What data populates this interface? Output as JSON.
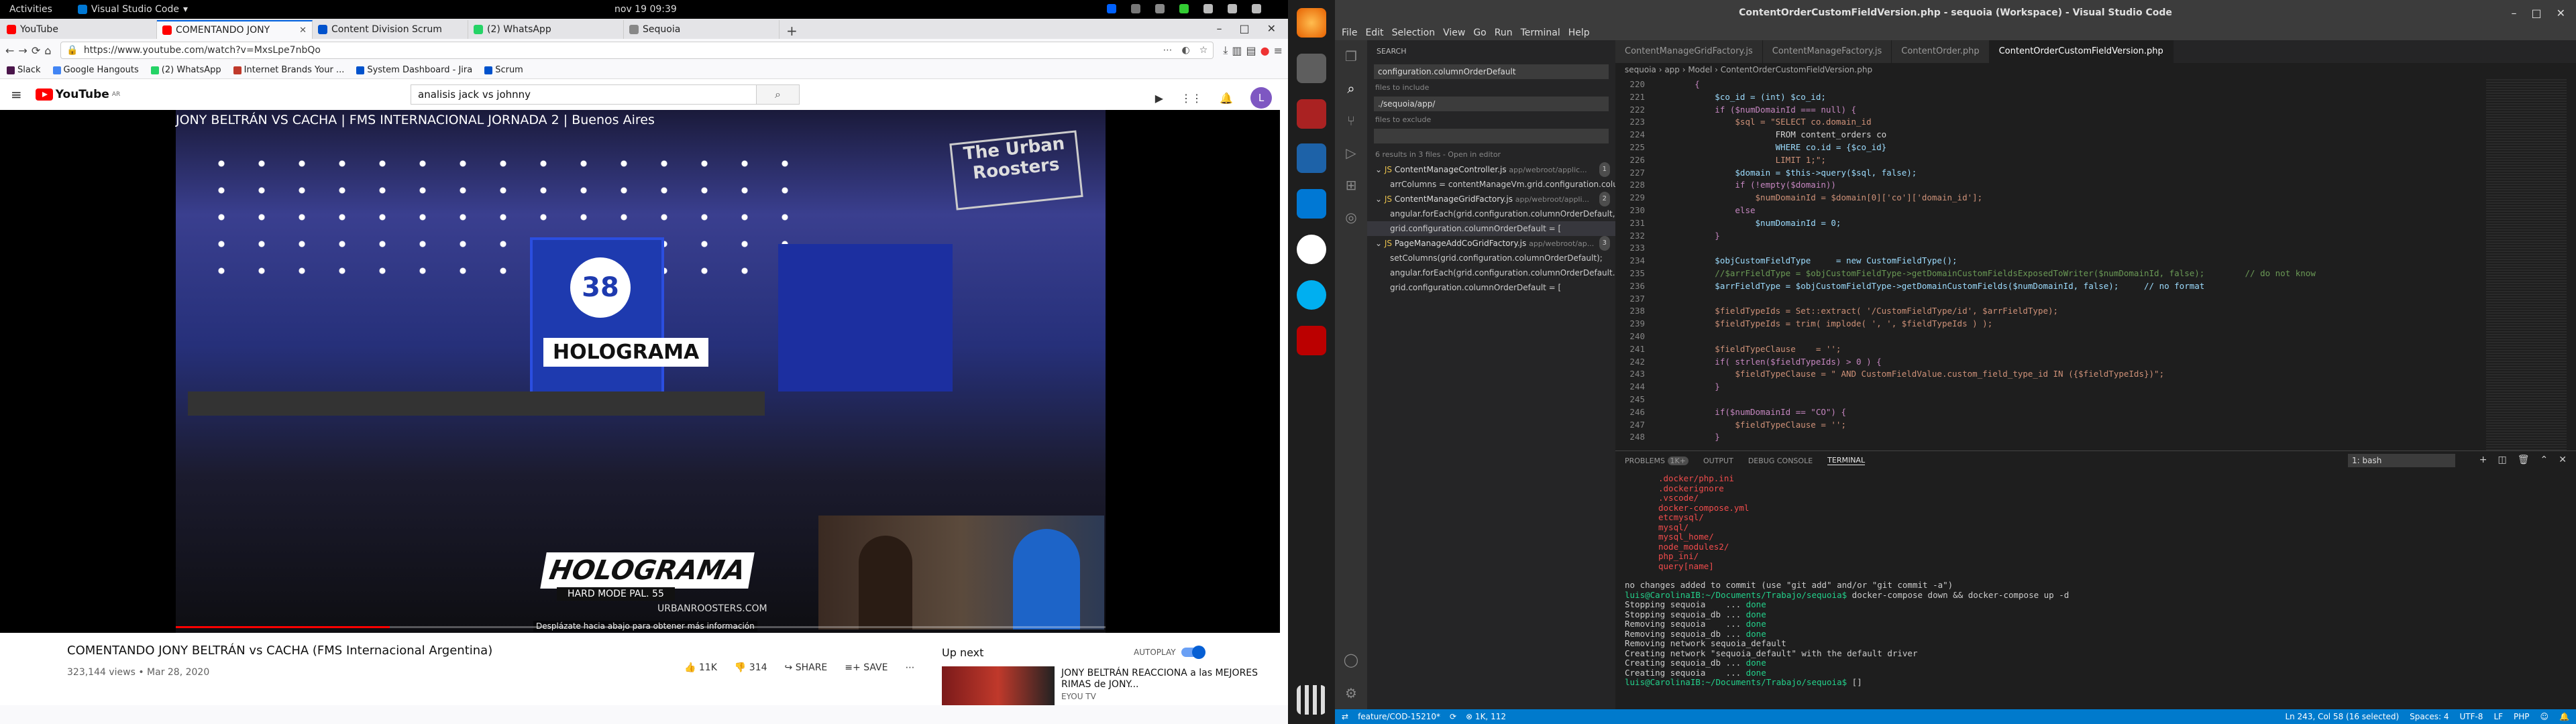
{
  "gnome": {
    "activities": "Activities",
    "app": "Visual Studio Code",
    "clock": "nov 19  09:39"
  },
  "firefox": {
    "tabs": [
      {
        "label": "YouTube",
        "color": "#ff0000"
      },
      {
        "label": "COMENTANDO JONY",
        "color": "#ff0000"
      },
      {
        "label": "Content Division Scrum",
        "color": "#0052cc"
      },
      {
        "label": "(2) WhatsApp",
        "color": "#25d366"
      },
      {
        "label": "Sequoia",
        "color": "#555555"
      }
    ],
    "url": "https://www.youtube.com/watch?v=MxsLpe7nbQo",
    "bookmarks": [
      "Slack",
      "Google Hangouts",
      "(2) WhatsApp",
      "Internet Brands Your ...",
      "System Dashboard - Jira",
      "Scrum"
    ]
  },
  "youtube": {
    "logo": "YouTube",
    "country": "AR",
    "search_value": "analisis jack vs johnny",
    "avatar": "L",
    "video_overlay_title": "JONY BELTRÁN VS CACHA | FMS INTERNACIONAL JORNADA 2 | Buenos Aires",
    "overlay": {
      "badge": "38",
      "hologram": "HOLOGRAMA",
      "hard": "HARD MODE    PAL. 55",
      "site": "URBANROOSTERS.COM",
      "mid": "HOLOGRAMA",
      "logo": "The Urban Roosters",
      "caption": "Desplázate hacia abajo para obtener más información"
    },
    "progress_fraction": 0.23,
    "title": "COMENTANDO JONY BELTRÁN vs CACHA (FMS Internacional Argentina)",
    "views": "323,144 views • Mar 28, 2020",
    "likes": "11K",
    "dislikes": "314",
    "share": "SHARE",
    "save": "SAVE",
    "up_next": "Up next",
    "autoplay": "AUTOPLAY",
    "next_title": "JONY BELTRÁN REACCIONA a las MEJORES RIMAS de JONY...",
    "next_channel": "EYOU TV"
  },
  "vscode": {
    "title": "ContentOrderCustomFieldVersion.php - sequoia (Workspace) - Visual Studio Code",
    "menu": [
      "File",
      "Edit",
      "Selection",
      "View",
      "Go",
      "Run",
      "Terminal",
      "Help"
    ],
    "search": {
      "header": "SEARCH",
      "query": "configuration.columnOrderDefault",
      "include_label": "files to include",
      "include": "./sequoia/app/",
      "exclude_label": "files to exclude",
      "summary": "6 results in 3 files - Open in editor",
      "results": [
        {
          "file": "ContentManageController.js",
          "path": "app/webroot/applic...",
          "count": "1",
          "matches": [
            "arrColumns = contentManageVm.grid.configuration.colum..."
          ]
        },
        {
          "file": "ContentManageGridFactory.js",
          "path": "app/webroot/appli...",
          "count": "2",
          "matches": [
            "angular.forEach(grid.configuration.columnOrderDefault,...",
            "grid.configuration.columnOrderDefault = ["
          ]
        },
        {
          "file": "PageManageAddCoGridFactory.js",
          "path": "app/webroot/ap...",
          "count": "3",
          "matches": [
            "setColumns(grid.configuration.columnOrderDefault);",
            "angular.forEach(grid.configuration.columnOrderDefault...",
            "grid.configuration.columnOrderDefault = ["
          ]
        }
      ]
    },
    "tabs": [
      "ContentManageGridFactory.js",
      "ContentManageFactory.js",
      "ContentOrder.php",
      "ContentOrderCustomFieldVersion.php"
    ],
    "breadcrumb": "sequoia › app › Model › ContentOrderCustomFieldVersion.php",
    "lines": [
      {
        "n": "220",
        "t": "        {"
      },
      {
        "n": "221",
        "t": "            $co_id = (int) $co_id;"
      },
      {
        "n": "222",
        "t": "            if ($numDomainId === null) {"
      },
      {
        "n": "223",
        "t": "                $sql = \"SELECT co.domain_id"
      },
      {
        "n": "224",
        "t": "                        FROM content_orders co"
      },
      {
        "n": "225",
        "t": "                        WHERE co.id = {$co_id}"
      },
      {
        "n": "226",
        "t": "                        LIMIT 1;\";"
      },
      {
        "n": "227",
        "t": "                $domain = $this->query($sql, false);"
      },
      {
        "n": "228",
        "t": "                if (!empty($domain))"
      },
      {
        "n": "229",
        "t": "                    $numDomainId = $domain[0]['co']['domain_id'];"
      },
      {
        "n": "230",
        "t": "                else"
      },
      {
        "n": "231",
        "t": "                    $numDomainId = 0;"
      },
      {
        "n": "232",
        "t": "            }"
      },
      {
        "n": "233",
        "t": ""
      },
      {
        "n": "234",
        "t": "            $objCustomFieldType     = new CustomFieldType();"
      },
      {
        "n": "235",
        "t": "            //$arrFieldType = $objCustomFieldType->getDomainCustomFieldsExposedToWriter($numDomainId, false);        // do not know"
      },
      {
        "n": "236",
        "t": "            $arrFieldType = $objCustomFieldType->getDomainCustomFields($numDomainId, false);     // no format"
      },
      {
        "n": "237",
        "t": ""
      },
      {
        "n": "238",
        "t": "            $fieldTypeIds = Set::extract( '/CustomFieldType/id', $arrFieldType);"
      },
      {
        "n": "239",
        "t": "            $fieldTypeIds = trim( implode( ', ', $fieldTypeIds ) );"
      },
      {
        "n": "240",
        "t": ""
      },
      {
        "n": "241",
        "t": "            $fieldTypeClause    = '';"
      },
      {
        "n": "242",
        "t": "            if( strlen($fieldTypeIds) > 0 ) {"
      },
      {
        "n": "243",
        "t": "                $fieldTypeClause = \" AND CustomFieldValue.custom_field_type_id IN ({$fieldTypeIds})\";"
      },
      {
        "n": "244",
        "t": "            }"
      },
      {
        "n": "245",
        "t": ""
      },
      {
        "n": "246",
        "t": "            if($numDomainId == \"CO\") {"
      },
      {
        "n": "247",
        "t": "                $fieldTypeClause = '';"
      },
      {
        "n": "248",
        "t": "            }"
      }
    ],
    "panel_tabs": [
      "PROBLEMS",
      "OUTPUT",
      "DEBUG CONSOLE",
      "TERMINAL"
    ],
    "problems_count": "1K+",
    "terminal_select": "1: bash",
    "terminal_red": [
      ".docker/php.ini",
      ".dockerignore",
      ".vscode/",
      "docker-compose.yml",
      "etcmysql/",
      "mysql/",
      "mysql_home/",
      "node_modules2/",
      "php_ini/",
      "query[name]"
    ],
    "terminal_lines": [
      {
        "t": "no changes added to commit (use \"git add\" and/or \"git commit -a\")",
        "c": "#cccccc"
      },
      {
        "t": "luis@CarolinaIB:~/Documents/Trabajo/sequoia$ docker-compose down && docker-compose up -d",
        "c": "#cccccc"
      },
      {
        "t": "Stopping sequoia    ... done",
        "c": "#cccccc"
      },
      {
        "t": "Stopping sequoia_db ... done",
        "c": "#cccccc"
      },
      {
        "t": "Removing sequoia    ... done",
        "c": "#cccccc"
      },
      {
        "t": "Removing sequoia_db ... done",
        "c": "#cccccc"
      },
      {
        "t": "Removing network sequoia_default",
        "c": "#cccccc"
      },
      {
        "t": "Creating network \"sequoia_default\" with the default driver",
        "c": "#cccccc"
      },
      {
        "t": "Creating sequoia_db ... done",
        "c": "#cccccc"
      },
      {
        "t": "Creating sequoia    ... done",
        "c": "#cccccc"
      },
      {
        "t": "luis@CarolinaIB:~/Documents/Trabajo/sequoia$ []",
        "c": "#cccccc"
      }
    ],
    "status": {
      "branch": "feature/COD-15210*",
      "sync": "⟳",
      "errors": "⊗ 1K, 112",
      "position": "Ln 243, Col 58 (16 selected)",
      "spaces": "Spaces: 4",
      "encoding": "UTF-8",
      "eol": "LF",
      "lang": "PHP"
    }
  }
}
